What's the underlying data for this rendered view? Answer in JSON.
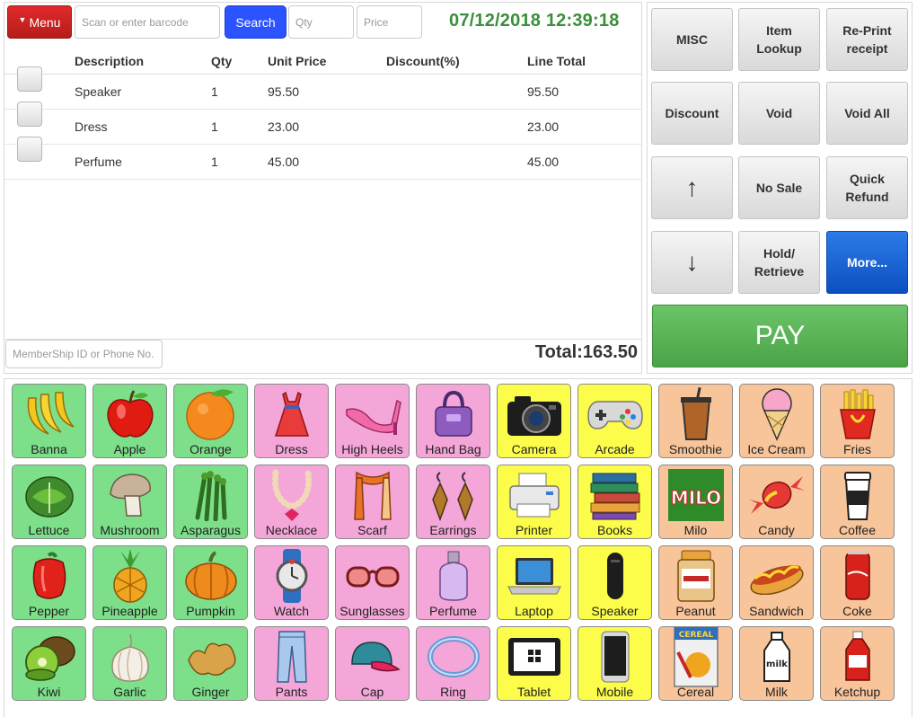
{
  "header": {
    "menu_label": "Menu",
    "barcode_placeholder": "Scan or enter barcode",
    "search_label": "Search",
    "qty_placeholder": "Qty",
    "price_placeholder": "Price",
    "datetime": "07/12/2018 12:39:18"
  },
  "cart": {
    "columns": [
      "Description",
      "Qty",
      "Unit Price",
      "Discount(%)",
      "Line Total"
    ],
    "items": [
      {
        "description": "Speaker",
        "qty": "1",
        "unit_price": "95.50",
        "discount": "",
        "line_total": "95.50"
      },
      {
        "description": "Dress",
        "qty": "1",
        "unit_price": "23.00",
        "discount": "",
        "line_total": "23.00"
      },
      {
        "description": "Perfume",
        "qty": "1",
        "unit_price": "45.00",
        "discount": "",
        "line_total": "45.00"
      }
    ],
    "membership_placeholder": "MemberShip ID or Phone No.",
    "total": "Total:163.50"
  },
  "functions": {
    "misc": "MISC",
    "item_lookup": "Item\nLookup",
    "reprint": "Re-Print\nreceipt",
    "discount": "Discount",
    "void": "Void",
    "void_all": "Void All",
    "up_arrow": "↑",
    "no_sale": "No Sale",
    "quick_refund": "Quick\nRefund",
    "down_arrow": "↓",
    "hold_retrieve": "Hold/\nRetrieve",
    "more": "More...",
    "pay": "PAY"
  },
  "colors": {
    "produce": "#7ddf8a",
    "fashion": "#f4a6d8",
    "electronics": "#fcfc4a",
    "food": "#f8c49a",
    "pay": "#5cb85c",
    "search": "#2b53ff",
    "menu": "#d32f2f"
  },
  "products": [
    [
      {
        "label": "Banna",
        "color": "green",
        "icon": "bananas"
      },
      {
        "label": "Apple",
        "color": "green",
        "icon": "apple"
      },
      {
        "label": "Orange",
        "color": "green",
        "icon": "orange"
      },
      {
        "label": "Dress",
        "color": "pink",
        "icon": "dress"
      },
      {
        "label": "High Heels",
        "color": "pink",
        "icon": "high-heel"
      },
      {
        "label": "Hand Bag",
        "color": "pink",
        "icon": "handbag"
      },
      {
        "label": "Camera",
        "color": "yellow",
        "icon": "camera"
      },
      {
        "label": "Arcade",
        "color": "yellow",
        "icon": "gamepad"
      },
      {
        "label": "Smoothie",
        "color": "orange",
        "icon": "smoothie"
      },
      {
        "label": "Ice Cream",
        "color": "orange",
        "icon": "ice-cream"
      },
      {
        "label": "Fries",
        "color": "orange",
        "icon": "fries"
      }
    ],
    [
      {
        "label": "Lettuce",
        "color": "green",
        "icon": "lettuce"
      },
      {
        "label": "Mushroom",
        "color": "green",
        "icon": "mushroom"
      },
      {
        "label": "Asparagus",
        "color": "green",
        "icon": "asparagus"
      },
      {
        "label": "Necklace",
        "color": "pink",
        "icon": "necklace"
      },
      {
        "label": "Scarf",
        "color": "pink",
        "icon": "scarf"
      },
      {
        "label": "Earrings",
        "color": "pink",
        "icon": "earrings"
      },
      {
        "label": "Printer",
        "color": "yellow",
        "icon": "printer"
      },
      {
        "label": "Books",
        "color": "yellow",
        "icon": "books"
      },
      {
        "label": "Milo",
        "color": "orange",
        "icon": "milo",
        "brand": "MILO"
      },
      {
        "label": "Candy",
        "color": "orange",
        "icon": "candy"
      },
      {
        "label": "Coffee",
        "color": "orange",
        "icon": "coffee"
      }
    ],
    [
      {
        "label": "Pepper",
        "color": "green",
        "icon": "pepper"
      },
      {
        "label": "Pineapple",
        "color": "green",
        "icon": "pineapple"
      },
      {
        "label": "Pumpkin",
        "color": "green",
        "icon": "pumpkin"
      },
      {
        "label": "Watch",
        "color": "pink",
        "icon": "watch"
      },
      {
        "label": "Sunglasses",
        "color": "pink",
        "icon": "sunglasses"
      },
      {
        "label": "Perfume",
        "color": "pink",
        "icon": "perfume"
      },
      {
        "label": "Laptop",
        "color": "yellow",
        "icon": "laptop"
      },
      {
        "label": "Speaker",
        "color": "yellow",
        "icon": "speaker"
      },
      {
        "label": "Peanut",
        "color": "orange",
        "icon": "peanut-jar"
      },
      {
        "label": "Sandwich",
        "color": "orange",
        "icon": "hotdog"
      },
      {
        "label": "Coke",
        "color": "orange",
        "icon": "coke-can"
      }
    ],
    [
      {
        "label": "Kiwi",
        "color": "green",
        "icon": "kiwi"
      },
      {
        "label": "Garlic",
        "color": "green",
        "icon": "garlic"
      },
      {
        "label": "Ginger",
        "color": "green",
        "icon": "ginger"
      },
      {
        "label": "Pants",
        "color": "pink",
        "icon": "pants"
      },
      {
        "label": "Cap",
        "color": "pink",
        "icon": "cap"
      },
      {
        "label": "Ring",
        "color": "pink",
        "icon": "ring"
      },
      {
        "label": "Tablet",
        "color": "yellow",
        "icon": "tablet"
      },
      {
        "label": "Mobile",
        "color": "yellow",
        "icon": "mobile"
      },
      {
        "label": "Cereal",
        "color": "orange",
        "icon": "cereal-box",
        "brand": "CEREAL"
      },
      {
        "label": "Milk",
        "color": "orange",
        "icon": "milk-bottle",
        "brand": "milk"
      },
      {
        "label": "Ketchup",
        "color": "orange",
        "icon": "ketchup"
      }
    ]
  ]
}
